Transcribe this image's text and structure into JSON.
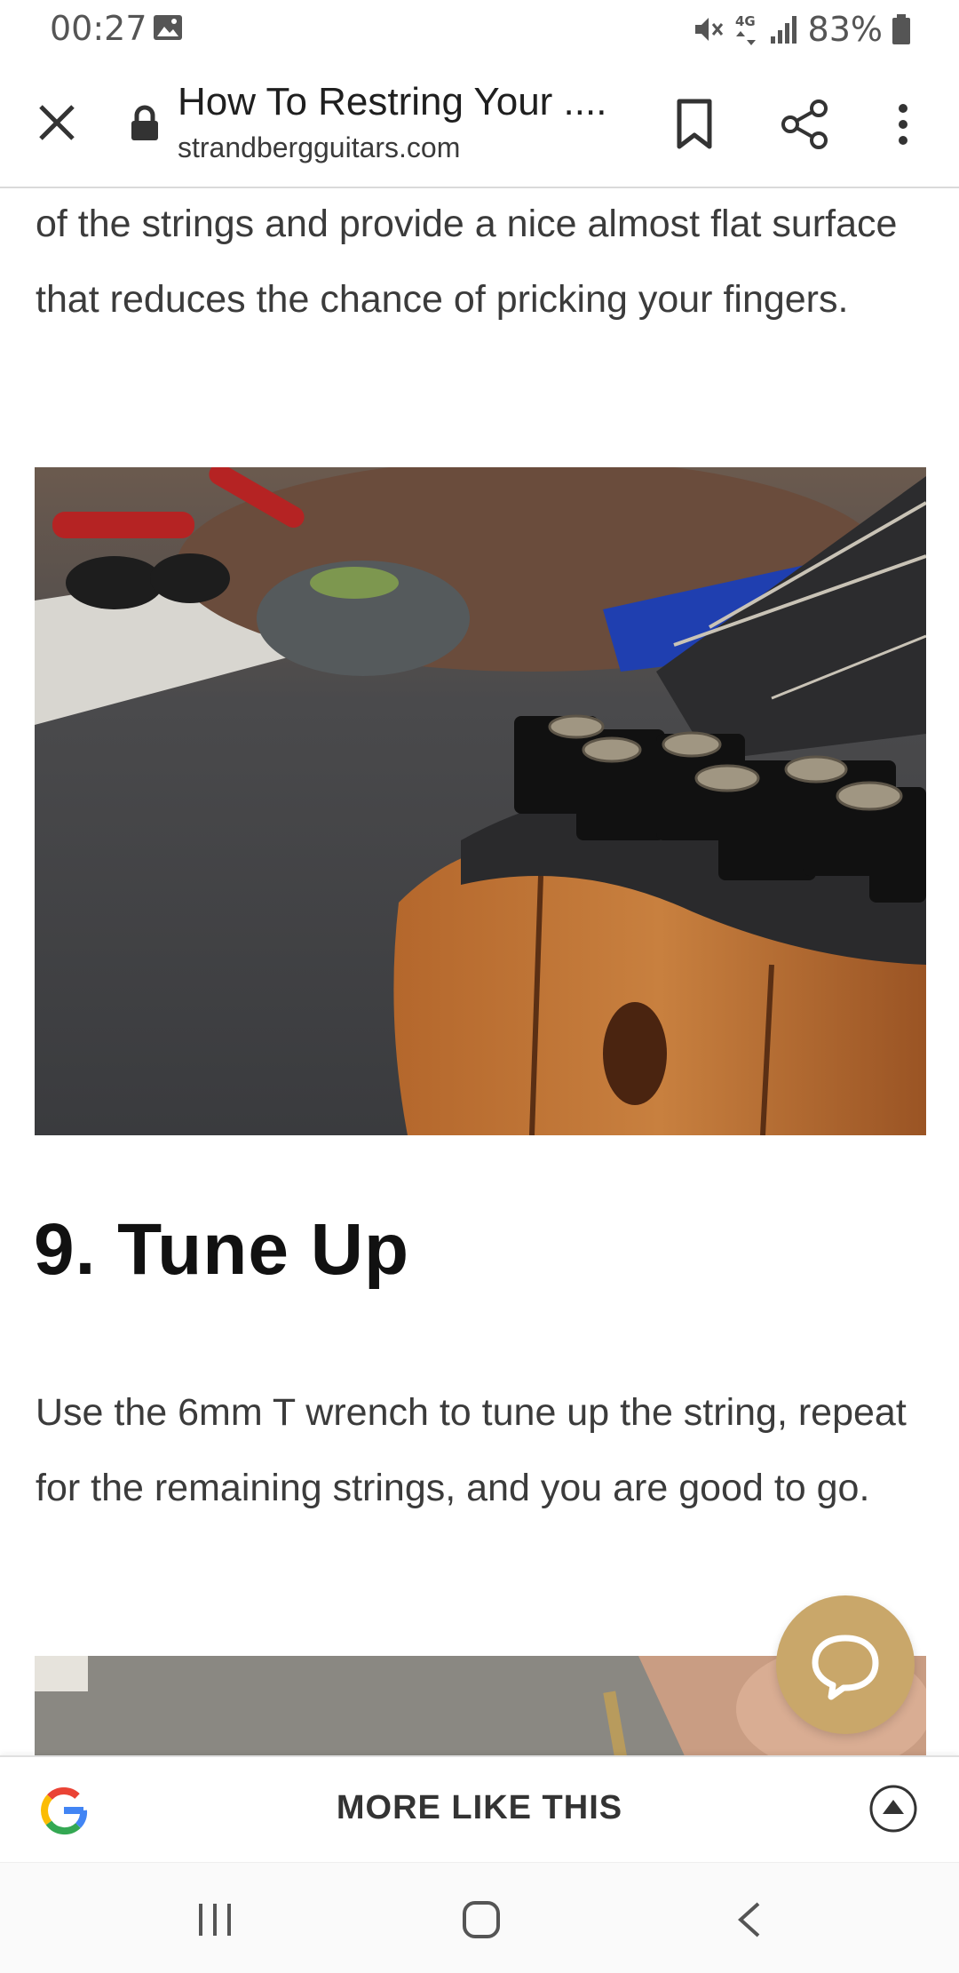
{
  "status_bar": {
    "time": "00:27",
    "battery": "83%",
    "network": "4G"
  },
  "toolbar": {
    "title": "How To Restring Your ....",
    "url": "strandbergguitars.com",
    "icons": [
      "close-icon",
      "lock-icon",
      "bookmark-icon",
      "share-icon",
      "more-vert-icon"
    ]
  },
  "article": {
    "paragraph_top": "of the strings and provide a nice almost flat surface that reduces the chance of pricking your fingers.",
    "heading": "9. Tune Up",
    "paragraph_tune": "Use the 6mm T wrench to tune up the string, repeat for the remaining strings, and you are good to go."
  },
  "chat": {
    "icon": "chat-bubble-icon",
    "color": "#c9a76a"
  },
  "more_like_this": {
    "label": "MORE LIKE THIS"
  },
  "colors": {
    "accent": "#c9a76a",
    "google_blue": "#4285F4",
    "google_red": "#EA4335",
    "google_yellow": "#FBBC05",
    "google_green": "#34A853"
  }
}
